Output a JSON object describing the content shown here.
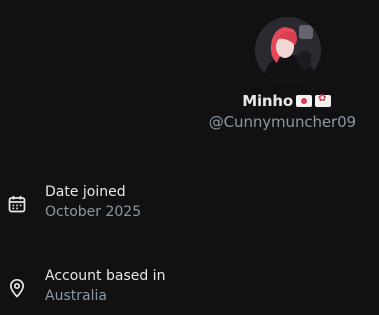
{
  "profile": {
    "display_name": "Minho",
    "handle": "@Cunnymuncher09",
    "badges": [
      "flag-icon-jp",
      "flag-icon-hk"
    ]
  },
  "details": [
    {
      "icon": "calendar-icon",
      "label": "Date joined",
      "value": "October 2025"
    },
    {
      "icon": "location-pin-icon",
      "label": "Account based in",
      "value": "Australia"
    }
  ],
  "colors": {
    "background": "#111112",
    "primary_text": "#e7e9ea",
    "secondary_text": "#8b98a5"
  }
}
